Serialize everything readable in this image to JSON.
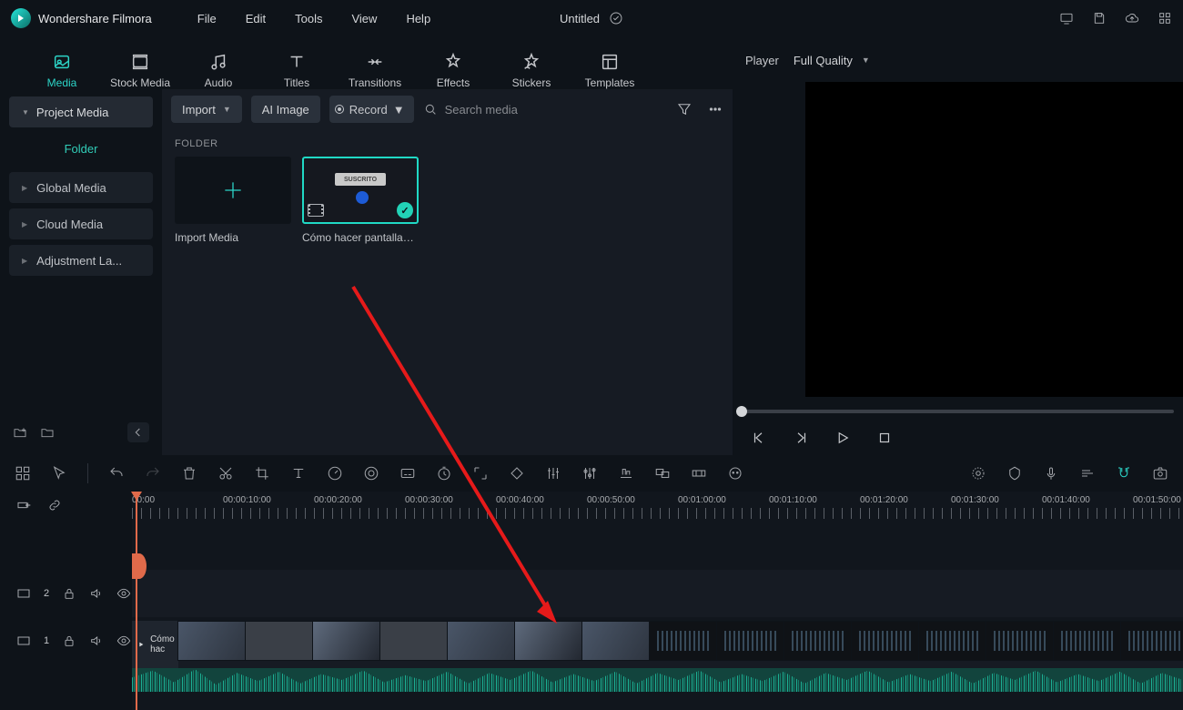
{
  "app_name": "Wondershare Filmora",
  "menubar": [
    "File",
    "Edit",
    "Tools",
    "View",
    "Help"
  ],
  "doc_title": "Untitled",
  "tabs": [
    {
      "key": "media",
      "label": "Media"
    },
    {
      "key": "stock",
      "label": "Stock Media"
    },
    {
      "key": "audio",
      "label": "Audio"
    },
    {
      "key": "titles",
      "label": "Titles"
    },
    {
      "key": "trans",
      "label": "Transitions"
    },
    {
      "key": "fx",
      "label": "Effects"
    },
    {
      "key": "stk",
      "label": "Stickers"
    },
    {
      "key": "tpl",
      "label": "Templates"
    }
  ],
  "active_tab": "media",
  "sidebar": {
    "project_media": "Project Media",
    "folder": "Folder",
    "items": [
      {
        "label": "Global Media"
      },
      {
        "label": "Cloud Media"
      },
      {
        "label": "Adjustment La..."
      }
    ]
  },
  "browser": {
    "import": "Import",
    "ai_image": "AI Image",
    "record": "Record",
    "search_placeholder": "Search media",
    "folder_header": "FOLDER",
    "import_tile": "Import Media",
    "clip_tile": "Cómo hacer pantallas ...",
    "suscrito": "SUSCRITO"
  },
  "player": {
    "label": "Player",
    "quality": "Full Quality"
  },
  "ruler_labels": [
    "00:00",
    "00:00:10:00",
    "00:00:20:00",
    "00:00:30:00",
    "00:00:40:00",
    "00:00:50:00",
    "00:01:00:00",
    "00:01:10:00",
    "00:01:20:00",
    "00:01:30:00",
    "00:01:40:00",
    "00:01:50:00"
  ],
  "track2_name": "2",
  "track1_name": "1",
  "clip_name": "Cómo hac"
}
